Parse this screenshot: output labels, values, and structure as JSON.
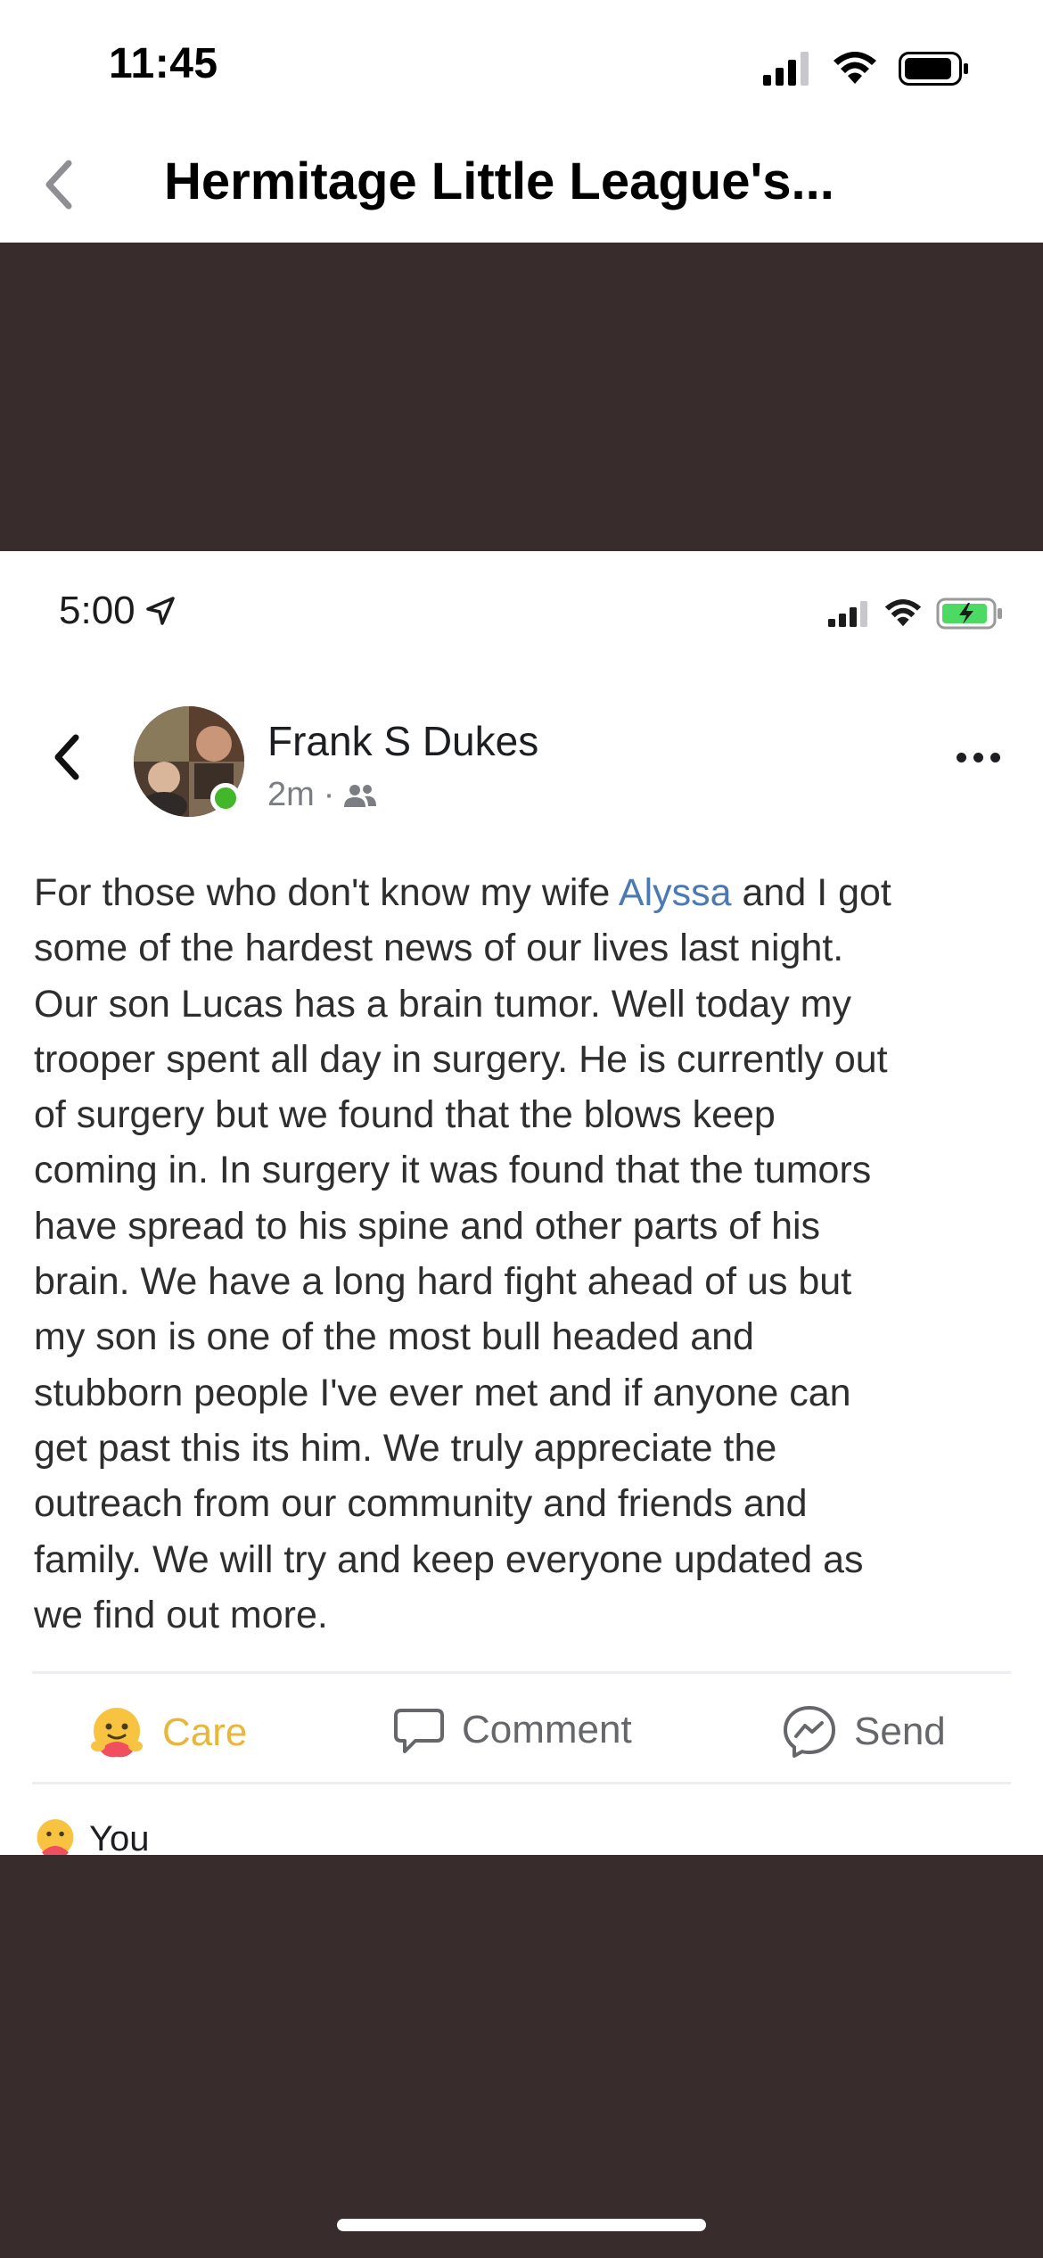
{
  "status_bar": {
    "time": "11:45"
  },
  "nav": {
    "title": "Hermitage Little League's..."
  },
  "inner_status": {
    "time": "5:00"
  },
  "post": {
    "author": "Frank S Dukes",
    "time": "2m",
    "meta_separator": "·",
    "mention": "Alyssa",
    "line1_before": "For those who don't know my wife",
    "line1_after": "and I got",
    "lines": [
      "some of the hardest news of our lives last night.",
      "Our son Lucas has a brain tumor. Well today my",
      "trooper spent all day in surgery. He is currently out",
      "of surgery but we found that the blows keep",
      "coming in. In surgery it was found that the tumors",
      "have spread to his spine and other parts of his",
      "brain. We have a long hard fight ahead of us but",
      "my son is one of the most bull headed and",
      "stubborn people I've ever met and if anyone can",
      "get past this its him. We truly appreciate the",
      "outreach from our community and friends and",
      "family. We will try and keep everyone updated as",
      "we find out more."
    ]
  },
  "actions": {
    "care": "Care",
    "comment": "Comment",
    "send": "Send"
  },
  "reactions": {
    "you_label": "You"
  },
  "colors": {
    "dark_band": "#382c2d",
    "mention": "#4a79b4",
    "care": "#e8b63a",
    "online": "#42b72a"
  },
  "icons": [
    "signal-icon",
    "wifi-icon",
    "battery-icon",
    "chevron-left-icon",
    "location-arrow-icon",
    "friends-icon",
    "more-icon",
    "care-emoji-icon",
    "comment-icon",
    "messenger-icon"
  ]
}
